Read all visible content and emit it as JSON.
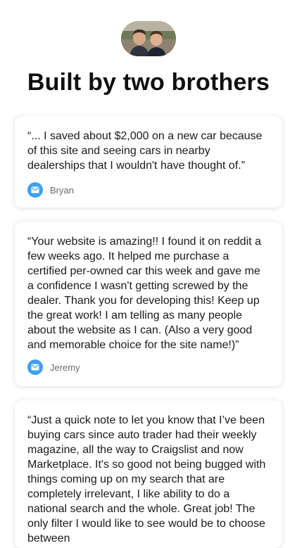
{
  "header": {
    "title": "Built by two brothers"
  },
  "testimonials": [
    {
      "quote": "“... I saved about $2,000 on a new car because of this site and seeing cars in nearby dealerships that I wouldn't have thought of.”",
      "author": "Bryan",
      "icon": "mail-icon"
    },
    {
      "quote": "“Your website is amazing!! I found it on reddit a few weeks ago. It helped me purchase a certified per-owned car this week and gave me a confidence I wasn't getting screwed by the dealer. Thank you for developing this! Keep up the great work! I am telling as many people about the website as I can. (Also a very good and memorable choice for the site name!)”",
      "author": "Jeremy",
      "icon": "mail-icon"
    },
    {
      "quote": "“Just a quick note to let you know that I’ve been buying cars since auto trader had their weekly magazine, all the way to Craigslist and now Marketplace. It's so good not being bugged with things coming up on my search that are completely irrelevant, I like ability to do a national search and the whole. Great job! The only filter I would like to see would be to choose between"
    }
  ],
  "colors": {
    "accent": "#3ea0f0",
    "text": "#1a1a1a",
    "muted": "#6b6b6b"
  }
}
